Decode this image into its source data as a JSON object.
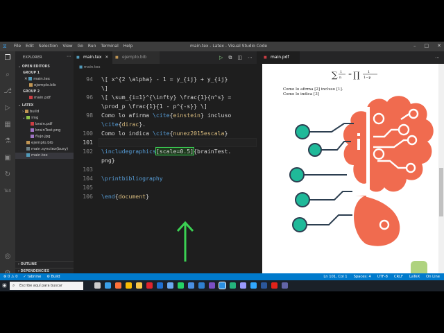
{
  "window": {
    "title": "main.tex - Latex - Visual Studio Code",
    "menu": [
      "File",
      "Edit",
      "Selection",
      "View",
      "Go",
      "Run",
      "Terminal",
      "Help"
    ]
  },
  "sidebar": {
    "header": "EXPLORER",
    "open_editors": "OPEN EDITORS",
    "group1": "GROUP 1",
    "group1_items": [
      "main.tex",
      "ejemplo.bib"
    ],
    "group2": "GROUP 2",
    "group2_items": [
      "main.pdf"
    ],
    "project": "LATEX",
    "tree": [
      {
        "label": "build",
        "kind": "folder",
        "indent": 1
      },
      {
        "label": "img",
        "kind": "folder",
        "indent": 1
      },
      {
        "label": "brain.pdf",
        "kind": "pdf",
        "indent": 2
      },
      {
        "label": "brainTest.png",
        "kind": "img",
        "indent": 2
      },
      {
        "label": "flujo.jpg",
        "kind": "img",
        "indent": 2
      },
      {
        "label": "ejemplo.bib",
        "kind": "bib",
        "indent": 1
      },
      {
        "label": "main.synctex(busy)",
        "kind": "file",
        "indent": 1
      },
      {
        "label": "main.tex",
        "kind": "tex",
        "indent": 1
      }
    ],
    "outline": "OUTLINE",
    "dependencies": "DEPENDENCIES"
  },
  "editor": {
    "tabs": [
      {
        "label": "main.tex",
        "active": true
      },
      {
        "label": "ejemplo.bib",
        "active": false
      }
    ],
    "breadcrumb": "main.tex",
    "lines": [
      {
        "n": "94",
        "parts": [
          [
            "\\[ x^{2 \\alpha} - 1 = y_{ij} + y_{ij}",
            "txt"
          ]
        ]
      },
      {
        "n": "",
        "parts": [
          [
            "\\]",
            "txt"
          ]
        ]
      },
      {
        "n": "96",
        "parts": [
          [
            "\\[ \\sum_{i=1}^{\\infty} \\frac{1}{n^s} =",
            "txt"
          ]
        ]
      },
      {
        "n": "",
        "parts": [
          [
            "\\prod_p \\frac{1}{1 - p^{-s}} \\]",
            "txt"
          ]
        ]
      },
      {
        "n": "98",
        "parts": [
          [
            "Como lo afirma ",
            "txt"
          ],
          [
            "\\cite",
            "kw"
          ],
          [
            "{",
            "txt"
          ],
          [
            "einstein",
            "arg"
          ],
          [
            "} incluso",
            "txt"
          ]
        ]
      },
      {
        "n": "",
        "parts": [
          [
            "\\cite",
            "kw"
          ],
          [
            "{",
            "txt"
          ],
          [
            "dirac",
            "arg"
          ],
          [
            "}.",
            "txt"
          ]
        ]
      },
      {
        "n": "100",
        "parts": [
          [
            "Como lo indica ",
            "txt"
          ],
          [
            "\\cite",
            "kw"
          ],
          [
            "{",
            "txt"
          ],
          [
            "nunez2015escala",
            "arg"
          ],
          [
            "}",
            "txt"
          ]
        ]
      },
      {
        "n": "101",
        "parts": [],
        "current": true
      },
      {
        "n": "102",
        "parts": [
          [
            "\\includegraphics",
            "kw"
          ],
          [
            "[scale=0.5]",
            "hl"
          ],
          [
            "{brainTest.",
            "txt"
          ]
        ]
      },
      {
        "n": "",
        "parts": [
          [
            "png}",
            "txt"
          ]
        ]
      },
      {
        "n": "103",
        "parts": []
      },
      {
        "n": "104",
        "parts": [
          [
            "\\printbibliography",
            "kw"
          ]
        ]
      },
      {
        "n": "105",
        "parts": []
      },
      {
        "n": "106",
        "parts": [
          [
            "\\end",
            "kw"
          ],
          [
            "{",
            "txt"
          ],
          [
            "document",
            "arg"
          ],
          [
            "}",
            "txt"
          ]
        ]
      }
    ]
  },
  "pdf": {
    "tab": "main.pdf",
    "line1": "Como lo afirma [2] incluso [1].",
    "line2": "Como lo indica [3]"
  },
  "statusbar": {
    "left": [
      "⊗ 0  ⚠ 0",
      "✓ tabnine",
      "⚙ Build"
    ],
    "right": [
      "Ln 101, Col 1",
      "Spaces: 4",
      "UTF-8",
      "CRLF",
      "LaTeX",
      "On Line"
    ]
  },
  "taskbar": {
    "search_placeholder": "Escribe aquí para buscar",
    "icons": [
      "task-view",
      "edge",
      "firefox",
      "chrome",
      "explorer",
      "opera",
      "mail",
      "onedrive",
      "whatsapp",
      "photos",
      "store",
      "vscode-alt",
      "vscode",
      "code-insiders",
      "premiere",
      "photoshop",
      "word",
      "acrobat",
      "teams"
    ],
    "icon_colors": [
      "#cccccc",
      "#3aa0ea",
      "#ff7139",
      "#fbbc05",
      "#f8c64a",
      "#e0232e",
      "#1f6fd0",
      "#6aa9f0",
      "#25d366",
      "#4a90e2",
      "#2f80d0",
      "#7b4fc4",
      "#2b8fe0",
      "#24b47e",
      "#9999ff",
      "#31a8ff",
      "#2b579a",
      "#e2231a",
      "#6264a7"
    ]
  },
  "colors": {
    "highlight": "#3bd153",
    "brain": "#f06b4f",
    "nodes": "#1fb999",
    "statusbar": "#007acc"
  }
}
